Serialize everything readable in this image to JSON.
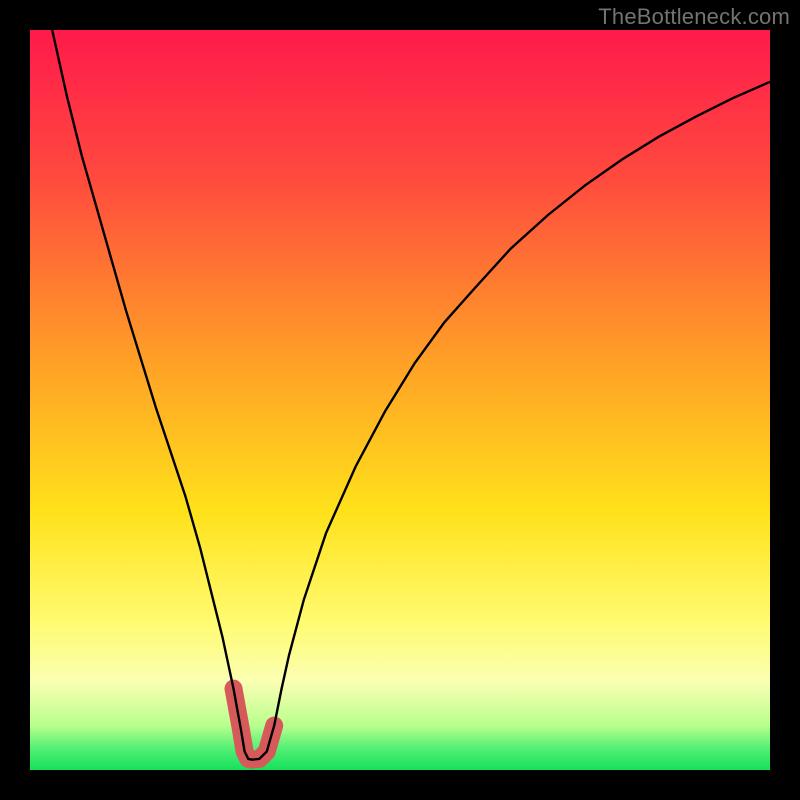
{
  "watermark": "TheBottleneck.com",
  "chart_data": {
    "type": "line",
    "title": "",
    "xlabel": "",
    "ylabel": "",
    "xlim": [
      0,
      100
    ],
    "ylim": [
      0,
      100
    ],
    "gradient_stops": [
      {
        "offset": 0,
        "color": "#ff1a4b"
      },
      {
        "offset": 20,
        "color": "#ff4a3e"
      },
      {
        "offset": 45,
        "color": "#ffa126"
      },
      {
        "offset": 65,
        "color": "#ffe11a"
      },
      {
        "offset": 80,
        "color": "#fffb70"
      },
      {
        "offset": 88,
        "color": "#fbffb3"
      },
      {
        "offset": 94,
        "color": "#b8ff8d"
      },
      {
        "offset": 97,
        "color": "#55f075"
      },
      {
        "offset": 100,
        "color": "#14e05c"
      }
    ],
    "series": [
      {
        "name": "bottleneck-curve",
        "x": [
          3,
          5,
          7,
          9,
          11,
          13,
          15,
          17,
          19,
          21,
          23,
          24.5,
          26,
          27.5,
          28.5,
          29,
          29.5,
          30,
          31,
          32,
          33,
          34,
          35,
          37,
          40,
          44,
          48,
          52,
          56,
          60,
          65,
          70,
          75,
          80,
          85,
          90,
          95,
          100
        ],
        "values": [
          100,
          91,
          83,
          76,
          69,
          62,
          55.5,
          49,
          43,
          37,
          30,
          24,
          18,
          11,
          5.5,
          2.5,
          1.5,
          1.4,
          1.5,
          2.5,
          6,
          11,
          15.5,
          23,
          32,
          41,
          48.5,
          55,
          60.5,
          65,
          70.5,
          75,
          79,
          82.5,
          85.6,
          88.3,
          90.8,
          93
        ]
      },
      {
        "name": "highlight-segment",
        "x": [
          27.5,
          28.5,
          29,
          29.5,
          30,
          31,
          32,
          33
        ],
        "values": [
          11,
          5.5,
          2.5,
          1.5,
          1.4,
          1.5,
          2.5,
          6
        ],
        "color": "#d65a5a",
        "stroke_width": 18
      }
    ]
  }
}
